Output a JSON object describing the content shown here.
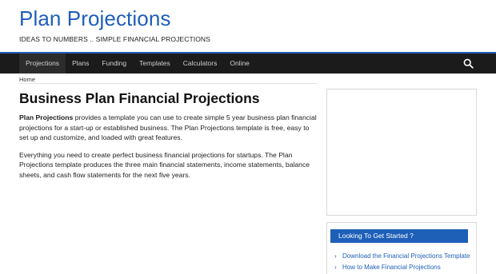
{
  "header": {
    "title": "Plan Projections",
    "tagline": "IDEAS TO NUMBERS .. SIMPLE FINANCIAL PROJECTIONS"
  },
  "nav": {
    "items": [
      {
        "label": "Projections"
      },
      {
        "label": "Plans"
      },
      {
        "label": "Funding"
      },
      {
        "label": "Templates"
      },
      {
        "label": "Calculators"
      },
      {
        "label": "Online"
      }
    ],
    "search_icon": "search-icon"
  },
  "breadcrumb": {
    "home": "Home"
  },
  "main": {
    "title": "Business Plan Financial Projections",
    "para1_bold": "Plan Projections",
    "para1_rest": " provides a template you can use to create simple 5 year business plan financial projections for a start-up or established business. The Plan Projections template is free, easy to set up and customize, and loaded with great features.",
    "para2": "Everything you need to create perfect business financial projections for startups. The Plan Projections template produces the three main financial statements, income statements, balance sheets, and cash flow statements for the next five years."
  },
  "sidebar": {
    "widget_title": "Looking To Get Started ?",
    "links": [
      {
        "label": "Download the Financial Projections Template"
      },
      {
        "label": "How to Make Financial Projections"
      }
    ]
  },
  "colors": {
    "brand_blue": "#1e5fb8",
    "nav_bg": "#1b1b1b"
  }
}
